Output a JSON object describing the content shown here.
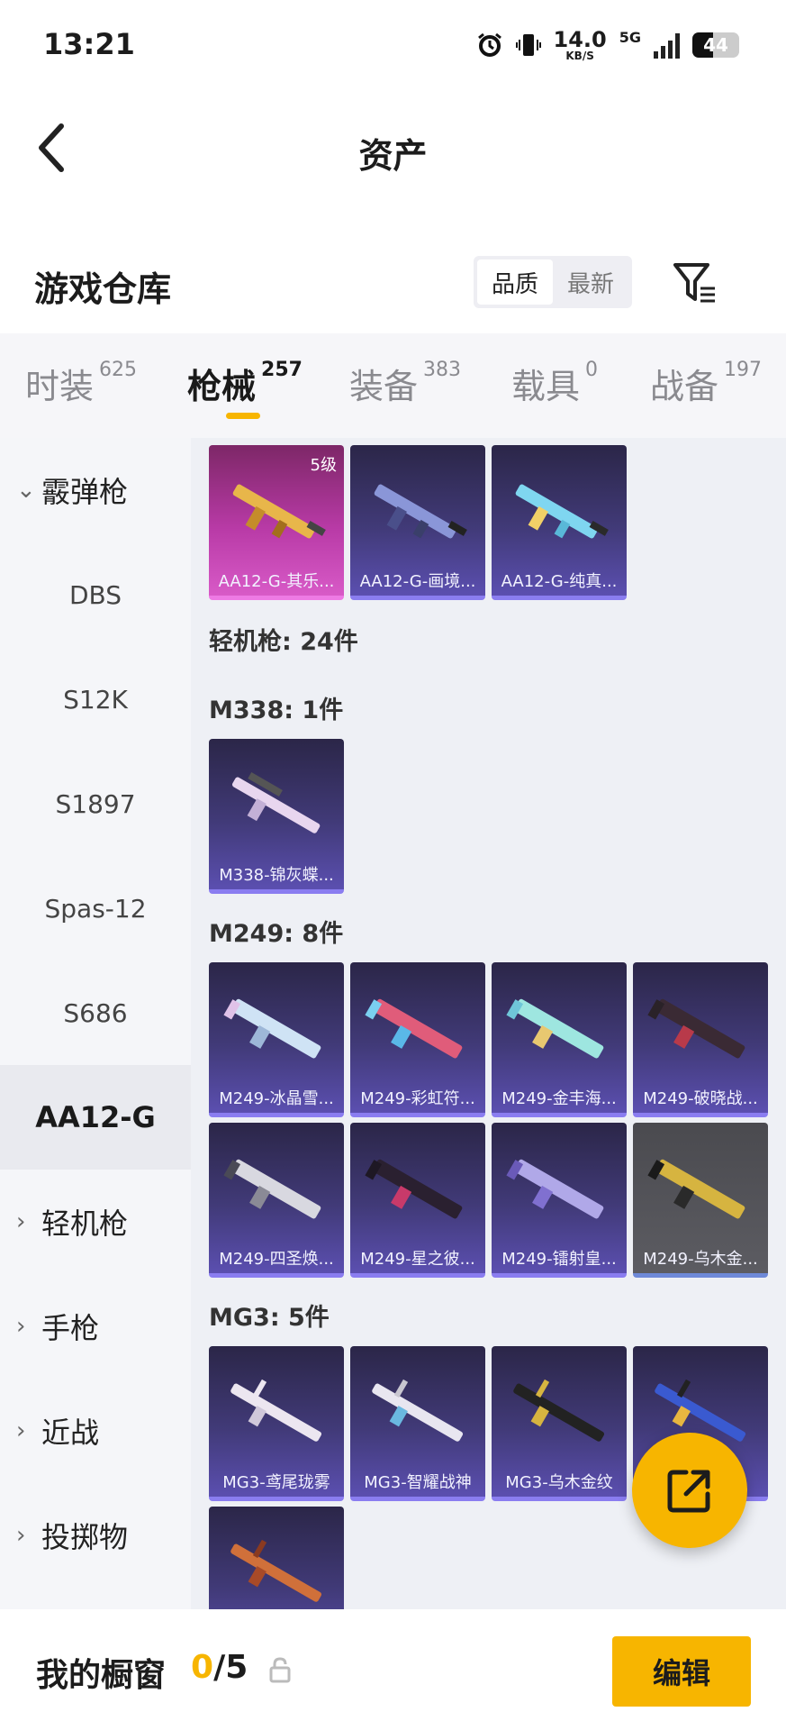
{
  "status_bar": {
    "time": "13:21",
    "speed_value": "14.0",
    "speed_unit": "KB/S",
    "network": "5G",
    "battery": "44",
    "battery_level": 0.44
  },
  "header": {
    "title": "资产"
  },
  "warehouse": {
    "title": "游戏仓库",
    "sort_options": [
      "品质",
      "最新"
    ],
    "active_sort": "品质"
  },
  "tabs": [
    {
      "label": "时装",
      "count": "625"
    },
    {
      "label": "枪械",
      "count": "257",
      "active": true
    },
    {
      "label": "装备",
      "count": "383"
    },
    {
      "label": "载具",
      "count": "0"
    },
    {
      "label": "战备",
      "count": "197"
    }
  ],
  "sidebar": {
    "shotgun": "霰弹枪",
    "shotgun_items": [
      "DBS",
      "S12K",
      "S1897",
      "Spas-12",
      "S686",
      "AA12-G"
    ],
    "active_item": "AA12-G",
    "lmg": "轻机枪",
    "pistol": "手枪",
    "melee": "近战",
    "throwable": "投掷物"
  },
  "content": {
    "aa12_cards": [
      {
        "name": "AA12-G-其乐...",
        "level": "5级",
        "quality": "pink"
      },
      {
        "name": "AA12-G-画境...",
        "quality": "purple"
      },
      {
        "name": "AA12-G-纯真...",
        "quality": "purple"
      }
    ],
    "lmg_header": "轻机枪: 24件",
    "m338_header": "M338: 1件",
    "m338_cards": [
      {
        "name": "M338-锦灰蝶..."
      }
    ],
    "m249_header": "M249: 8件",
    "m249_cards": [
      {
        "name": "M249-冰晶雪..."
      },
      {
        "name": "M249-彩虹符..."
      },
      {
        "name": "M249-金丰海..."
      },
      {
        "name": "M249-破晓战..."
      },
      {
        "name": "M249-四圣焕..."
      },
      {
        "name": "M249-星之彼..."
      },
      {
        "name": "M249-镭射皇..."
      },
      {
        "name": "M249-乌木金...",
        "quality": "gray"
      }
    ],
    "mg3_header": "MG3: 5件",
    "mg3_cards": [
      {
        "name": "MG3-鸢尾珑雾"
      },
      {
        "name": "MG3-智耀战神"
      },
      {
        "name": "MG3-乌木金纹"
      },
      {
        "name": ""
      },
      {
        "name": ""
      }
    ]
  },
  "bottom_bar": {
    "label": "我的橱窗",
    "current": "0",
    "total": "/5",
    "edit": "编辑"
  },
  "colors": {
    "accent": "#f7b500",
    "card_purple": "#413a78",
    "card_pink": "#b83aa6",
    "card_gray": "#5c5c62"
  },
  "icons": [
    "back-arrow-icon",
    "filter-icon",
    "lock-icon",
    "share-icon",
    "alarm-icon",
    "vibrate-icon",
    "signal-icon",
    "battery-icon"
  ]
}
